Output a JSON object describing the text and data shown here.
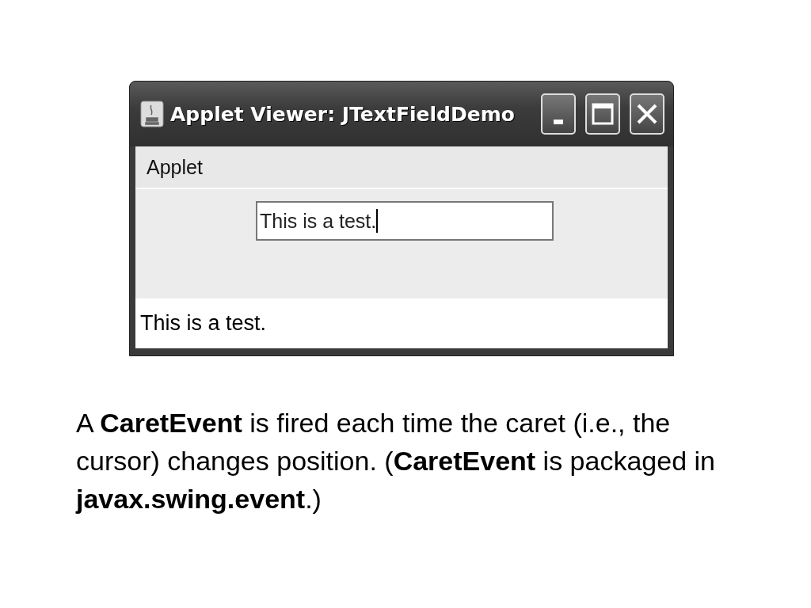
{
  "window": {
    "title": "Applet Viewer: JTextFieldDemo"
  },
  "menu_bar": {
    "items": [
      "Applet"
    ]
  },
  "text_field": {
    "value": "This is a test."
  },
  "status_bar": {
    "text": "This is a test."
  },
  "caption": "A **CaretEvent** is fired each time the caret (i.e., the cursor) changes position. (**CaretEvent** is packaged in **javax.swing.event**.)"
}
